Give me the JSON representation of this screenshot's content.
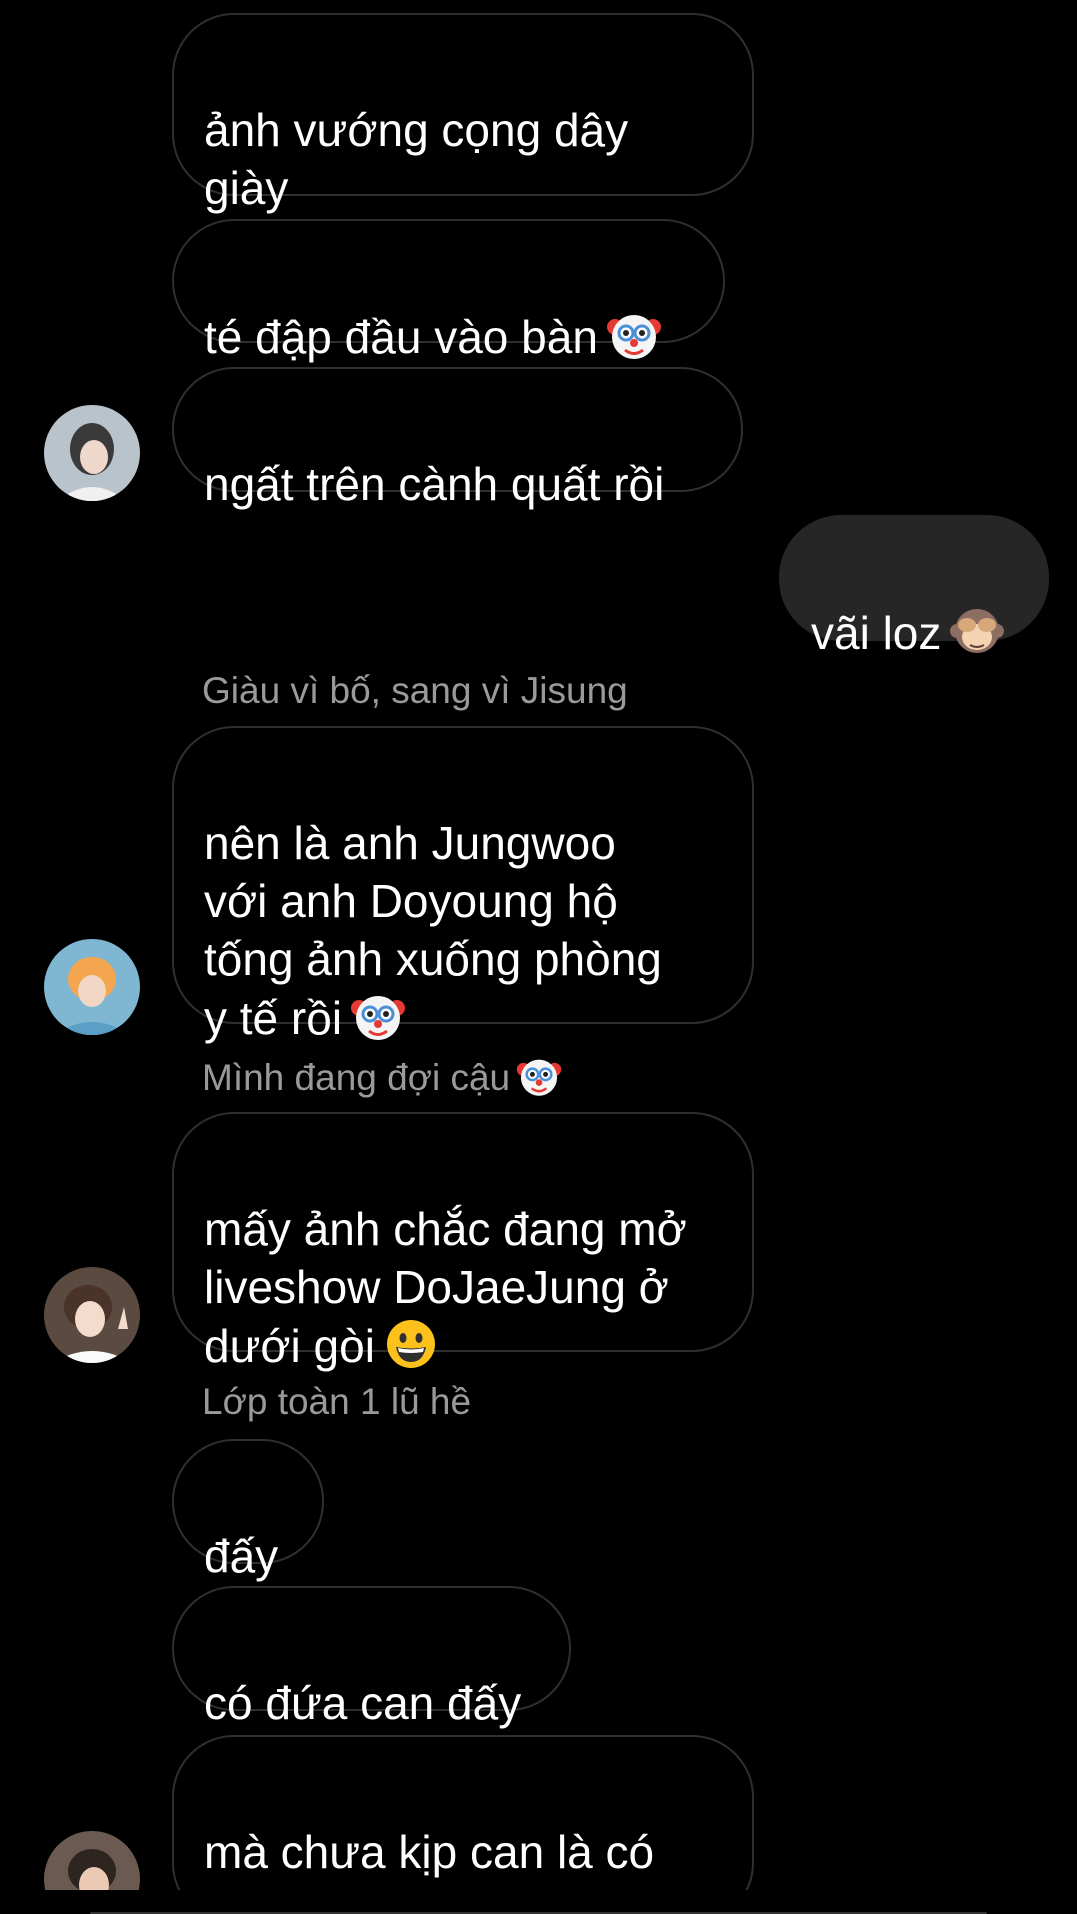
{
  "messages": [
    {
      "text": "ảnh vướng cọng dây\ngiày"
    },
    {
      "text": "té đập đầu vào bàn",
      "emoji": "clown-face"
    },
    {
      "text": "ngất trên cành quất rồi"
    },
    {
      "text": "vãi loz",
      "emoji": "see-no-evil-monkey"
    },
    {
      "text": "nên là anh Jungwoo\nvới anh Doyoung hộ\ntống ảnh xuống phòng\ny tế rồi",
      "emoji": "clown-face"
    },
    {
      "text": "mấy ảnh chắc đang mở\nliveshow DoJaeJung ở\ndưới gòi",
      "emoji": "grinning-face"
    },
    {
      "text": "đấy"
    },
    {
      "text": "có đứa can đấy"
    },
    {
      "text": "mà chưa kịp can là có\nchiện rồi :)))"
    }
  ],
  "senders": [
    {
      "name": "Giàu vì bố, sang vì Jisung"
    },
    {
      "name": "Mình đang đợi cậu",
      "emoji": "clown-face"
    },
    {
      "name": "Lớp toàn 1 lũ hề"
    }
  ],
  "colors": {
    "background": "#000000",
    "outgoing_bubble": "#262626",
    "incoming_border": "#2f2f2f",
    "sender_text": "#9a9a9a",
    "message_text": "#ffffff"
  }
}
